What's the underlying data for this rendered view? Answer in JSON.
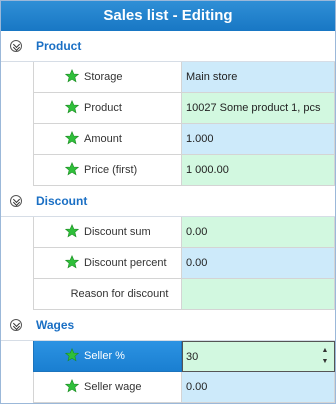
{
  "window": {
    "title": "Sales list - Editing"
  },
  "sections": {
    "product": {
      "title": "Product",
      "rows": [
        {
          "label": "Storage",
          "value": "Main store"
        },
        {
          "label": "Product",
          "value": "10027 Some product 1, pcs"
        },
        {
          "label": "Amount",
          "value": "1.000"
        },
        {
          "label": "Price (first)",
          "value": "1 000.00"
        }
      ]
    },
    "discount": {
      "title": "Discount",
      "rows": [
        {
          "label": "Discount sum",
          "value": "0.00"
        },
        {
          "label": "Discount percent",
          "value": "0.00"
        },
        {
          "label": "Reason for discount",
          "value": ""
        }
      ]
    },
    "wages": {
      "title": "Wages",
      "rows": [
        {
          "label": "Seller %",
          "value": "30"
        },
        {
          "label": "Seller wage",
          "value": "0.00"
        }
      ]
    }
  },
  "icons": {
    "collapse": "collapse-chevrons-icon",
    "star": "green-star-icon",
    "spinner": "spin-up-down-icon"
  },
  "colors": {
    "title_bar": "#1e82cd",
    "section_title": "#1a6fc4",
    "value_blue": "#cdeafa",
    "value_green": "#d2f8e0",
    "star_green": "#2fbf3a",
    "selected": "#1f86d6"
  }
}
